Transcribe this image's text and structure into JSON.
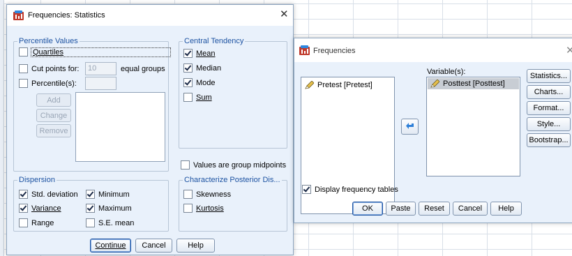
{
  "stats_dialog": {
    "title": "Frequencies: Statistics",
    "percentile_values": {
      "legend": "Percentile Values",
      "quartiles": "Quartiles",
      "cut_points_for": "Cut points for:",
      "cut_points_value": "10",
      "equal_groups": "equal groups",
      "percentiles": "Percentile(s):",
      "add": "Add",
      "change": "Change",
      "remove": "Remove"
    },
    "central_tendency": {
      "legend": "Central Tendency",
      "mean": "Mean",
      "median": "Median",
      "mode": "Mode",
      "sum": "Sum"
    },
    "group_midpoints": "Values are group midpoints",
    "dispersion": {
      "legend": "Dispersion",
      "std_deviation": "Std. deviation",
      "minimum": "Minimum",
      "variance": "Variance",
      "maximum": "Maximum",
      "range": "Range",
      "se_mean": "S.E. mean"
    },
    "posterior": {
      "legend": "Characterize Posterior Dis...",
      "skewness": "Skewness",
      "kurtosis": "Kurtosis"
    },
    "buttons": {
      "continue": "Continue",
      "cancel": "Cancel",
      "help": "Help"
    }
  },
  "freq_dialog": {
    "title": "Frequencies",
    "source_list": [
      "Pretest [Pretest]"
    ],
    "variables_label": "Variable(s):",
    "variables_list": [
      "Posttest [Posttest]"
    ],
    "side_buttons": [
      "Statistics...",
      "Charts...",
      "Format...",
      "Style...",
      "Bootstrap..."
    ],
    "display_tables": "Display frequency tables",
    "bottom_buttons": {
      "ok": "OK",
      "paste": "Paste",
      "reset": "Reset",
      "cancel": "Cancel",
      "help": "Help"
    }
  },
  "colors": {
    "legend": "#1d53a2",
    "dialog_bg": "#e9f1fb",
    "selected_item": "#c8cdd4"
  }
}
